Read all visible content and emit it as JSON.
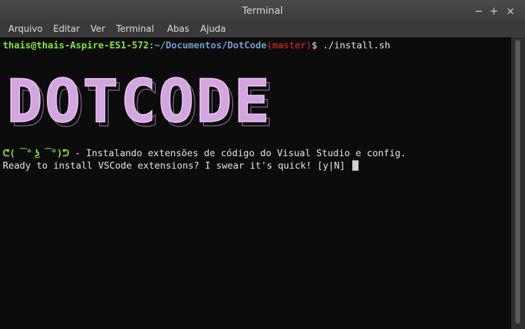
{
  "window": {
    "title": "Terminal",
    "controls": [
      "−",
      "+",
      "×"
    ]
  },
  "menu": {
    "items": [
      "Arquivo",
      "Editar",
      "Ver",
      "Terminal",
      "Abas",
      "Ajuda"
    ]
  },
  "terminal": {
    "prompt": {
      "user_host": "thais@thais-Aspire-ES1-572",
      "separator": ":",
      "path": "~/Documentos/DotCode",
      "branch": "(master)",
      "symbol": "$",
      "command": " ./install.sh"
    },
    "logo_text": "DOTCODE",
    "face": "ᕦ( ͡° ͜ʖ ͡°)ᕤ",
    "status_text": " - Instalando extensões de código do Visual Studio e config.",
    "question": "Ready to install VSCode extensions? I swear it's quick! [y|N] "
  },
  "colors": {
    "terminal_bg": "#0c0c0c",
    "user_green": "#8ae234",
    "path_blue": "#729fcf",
    "branch_red": "#ef2929",
    "logo_pink": "#d4a6df"
  }
}
